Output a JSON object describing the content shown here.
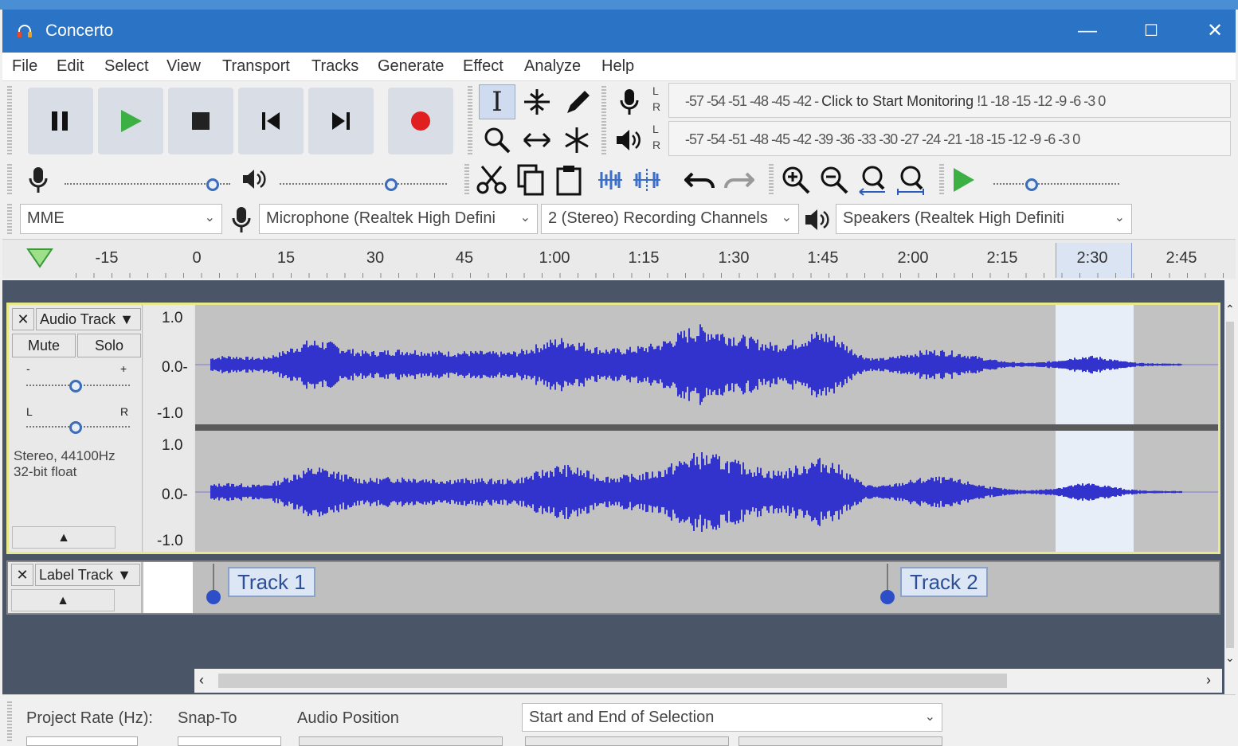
{
  "window": {
    "title": "Concerto",
    "minimize": "—",
    "maximize": "☐",
    "close": "✕"
  },
  "menu": [
    "File",
    "Edit",
    "Select",
    "View",
    "Transport",
    "Tracks",
    "Generate",
    "Effect",
    "Analyze",
    "Help"
  ],
  "meters": {
    "record_scale": "-57 -54 -51 -48 -45 -42 -",
    "record_hint": "Click to Start Monitoring",
    "record_scale_right": "!1 -18 -15 -12  -9  -6  -3  0",
    "play_scale": "-57 -54 -51 -48 -45 -42 -39 -36 -33 -30 -27 -24 -21 -18 -15 -12  -9  -6  -3  0",
    "lr_top": [
      "L",
      "R"
    ],
    "lr_bottom": [
      "L",
      "R"
    ]
  },
  "devices": {
    "host": "MME",
    "mic": "Microphone (Realtek High Defini",
    "channels": "2 (Stereo) Recording Channels",
    "speakers": "Speakers (Realtek High Definiti"
  },
  "ruler": {
    "ticks": [
      "-15",
      "0",
      "15",
      "30",
      "45",
      "1:00",
      "1:15",
      "1:30",
      "1:45",
      "2:00",
      "2:15",
      "2:30",
      "2:45"
    ]
  },
  "audio_track": {
    "name": "Audio Track",
    "mute": "Mute",
    "solo": "Solo",
    "gain_minus": "-",
    "gain_plus": "+",
    "pan_left": "L",
    "pan_right": "R",
    "info1": "Stereo, 44100Hz",
    "info2": "32-bit float",
    "scale_top": [
      "1.0",
      "0.0-",
      "-1.0"
    ],
    "scale_bottom": [
      "1.0",
      "0.0-",
      "-1.0"
    ]
  },
  "label_track": {
    "name": "Label Track",
    "labels": [
      "Track 1",
      "Track 2"
    ]
  },
  "statusbar": {
    "project_rate": "Project Rate (Hz):",
    "snap_to": "Snap-To",
    "audio_position": "Audio Position",
    "selection_mode": "Start and End of Selection"
  },
  "colors": {
    "waveform": "#3232cc",
    "selection": "#e8eef8",
    "title_bar": "#2b73c4"
  }
}
